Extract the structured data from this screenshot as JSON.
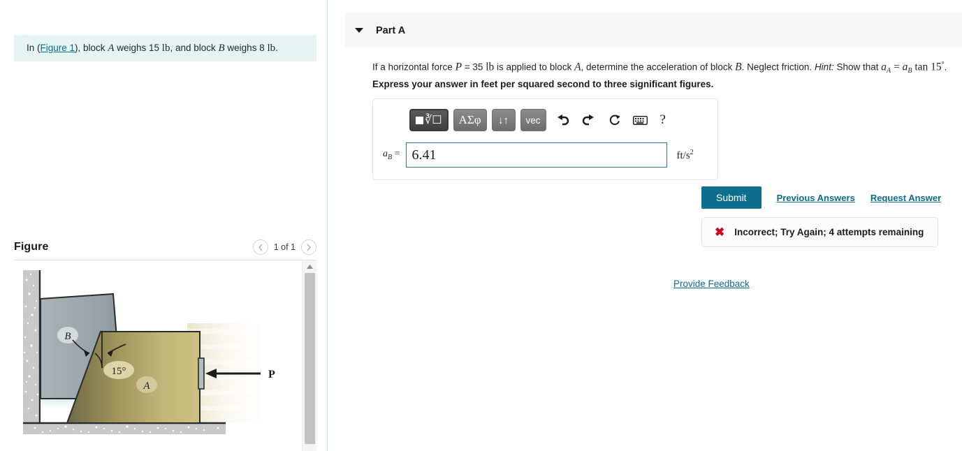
{
  "left": {
    "prompt": {
      "pre": "In (",
      "link": "Figure 1",
      "mid": "), block ",
      "blockA": "A",
      "mid2": " weighs 15 ",
      "unit1": "lb",
      "mid3": ", and block ",
      "blockB": "B",
      "mid4": " weighs 8 ",
      "unit2": "lb",
      "end": "."
    },
    "figure": {
      "title": "Figure",
      "page_count": "1 of 1",
      "prev_icon": "chevron-left-icon",
      "next_icon": "chevron-right-icon",
      "scroll_up_icon": "caret-up-icon",
      "diagram": {
        "label_a": "A",
        "label_b": "B",
        "angle": "15°",
        "force": "P"
      }
    }
  },
  "right": {
    "part": {
      "label": "Part A",
      "caret_icon": "caret-down-icon"
    },
    "question": {
      "t1": "If a horizontal force ",
      "p": "P",
      "t2": " = 35 ",
      "lb": "lb",
      "t3": " is applied to block ",
      "a": "A",
      "t4": ", determine the acceleration of block ",
      "b": "B",
      "t5": ". Neglect friction. ",
      "hint": "Hint:",
      "t6": " Show that ",
      "eq1": "a",
      "eq1sub": "A",
      "eqmid": " = ",
      "eq2": "a",
      "eq2sub": "B",
      "eqtan": " tan 15",
      "eqdeg": "°",
      "t7": ".",
      "bold": "Express your answer in feet per squared second to three significant figures."
    },
    "math_toolbar": {
      "template_btn": "template-icon",
      "greek_btn": "ΑΣφ",
      "arrows_btn": "↓↑",
      "vec_btn": "vec",
      "undo_icon": "undo-icon",
      "redo_icon": "redo-icon",
      "reset_icon": "reset-icon",
      "keyboard_icon": "keyboard-icon",
      "help_icon": "?"
    },
    "answer": {
      "label": "a",
      "label_sub": "B",
      "label_eq": " = ",
      "value": "6.41",
      "placeholder": "",
      "unit_main": "ft/s",
      "unit_sup": "2"
    },
    "actions": {
      "submit": "Submit",
      "previous_answers": "Previous Answers",
      "request_answer": "Request Answer"
    },
    "feedback": {
      "icon": "x-mark-icon",
      "text": "Incorrect; Try Again; 4 attempts remaining"
    },
    "provide_feedback": "Provide Feedback"
  },
  "colors": {
    "accent": "#0b6b8c",
    "submit": "#0d6e8e",
    "prompt_bg": "#e5f4f2",
    "error": "#d0021b",
    "block_a": "#b9a96a",
    "block_b": "#9fa9ad"
  }
}
